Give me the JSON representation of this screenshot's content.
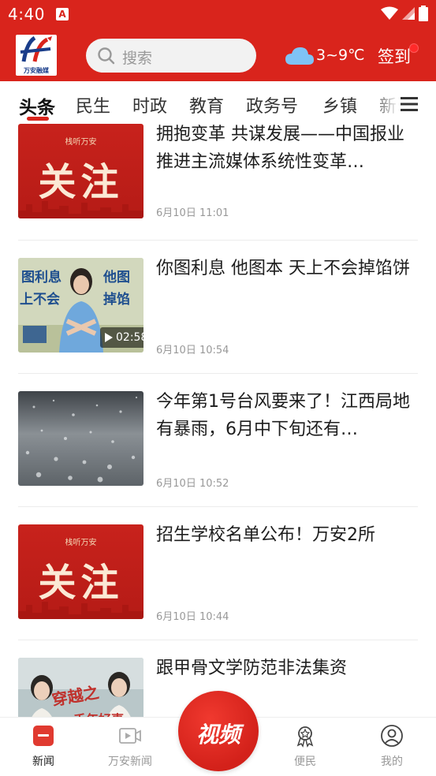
{
  "status_bar": {
    "time": "4:40",
    "app_icon_letter": "A"
  },
  "header": {
    "logo_text": "万安融媒",
    "search_placeholder": "搜索",
    "weather": "3~9℃",
    "signin_label": "签到"
  },
  "tabs": [
    {
      "label": "头条",
      "active": true
    },
    {
      "label": "民生",
      "active": false
    },
    {
      "label": "时政",
      "active": false
    },
    {
      "label": "教育",
      "active": false
    },
    {
      "label": "政务号",
      "active": false
    },
    {
      "label": "乡镇",
      "active": false
    },
    {
      "label": "新",
      "active": false
    }
  ],
  "articles": [
    {
      "title": "拥抱变革 共谋发展——中国报业推进主流媒体系统性变革…",
      "time": "6月10日 11:01",
      "thumb_type": "guanzhu",
      "thumb_brand": "栈听万安",
      "thumb_text": "关注"
    },
    {
      "title": "你图利息 他图本 天上不会掉馅饼",
      "time": "6月10日 10:54",
      "thumb_type": "video",
      "thumb_overlay_left": "图利息\n上不会",
      "thumb_overlay_right": "他图\n掉馅",
      "duration": "02:58"
    },
    {
      "title": "今年第1号台风要来了！江西局地有暴雨，6月中下旬还有…",
      "time": "6月10日 10:52",
      "thumb_type": "rain"
    },
    {
      "title": "招生学校名单公布！万安2所",
      "time": "6月10日 10:44",
      "thumb_type": "guanzhu",
      "thumb_brand": "栈听万安",
      "thumb_text": "关注"
    },
    {
      "title": "跟甲骨文学防范非法集资",
      "time": "",
      "thumb_type": "people"
    }
  ],
  "bottom_nav": {
    "news": "新闻",
    "wanan_news": "万安新闻",
    "video": "视频",
    "service": "便民",
    "mine": "我的"
  },
  "colors": {
    "brand_red": "#d9241c",
    "text_primary": "#1d1d1d",
    "text_meta": "#999999"
  }
}
